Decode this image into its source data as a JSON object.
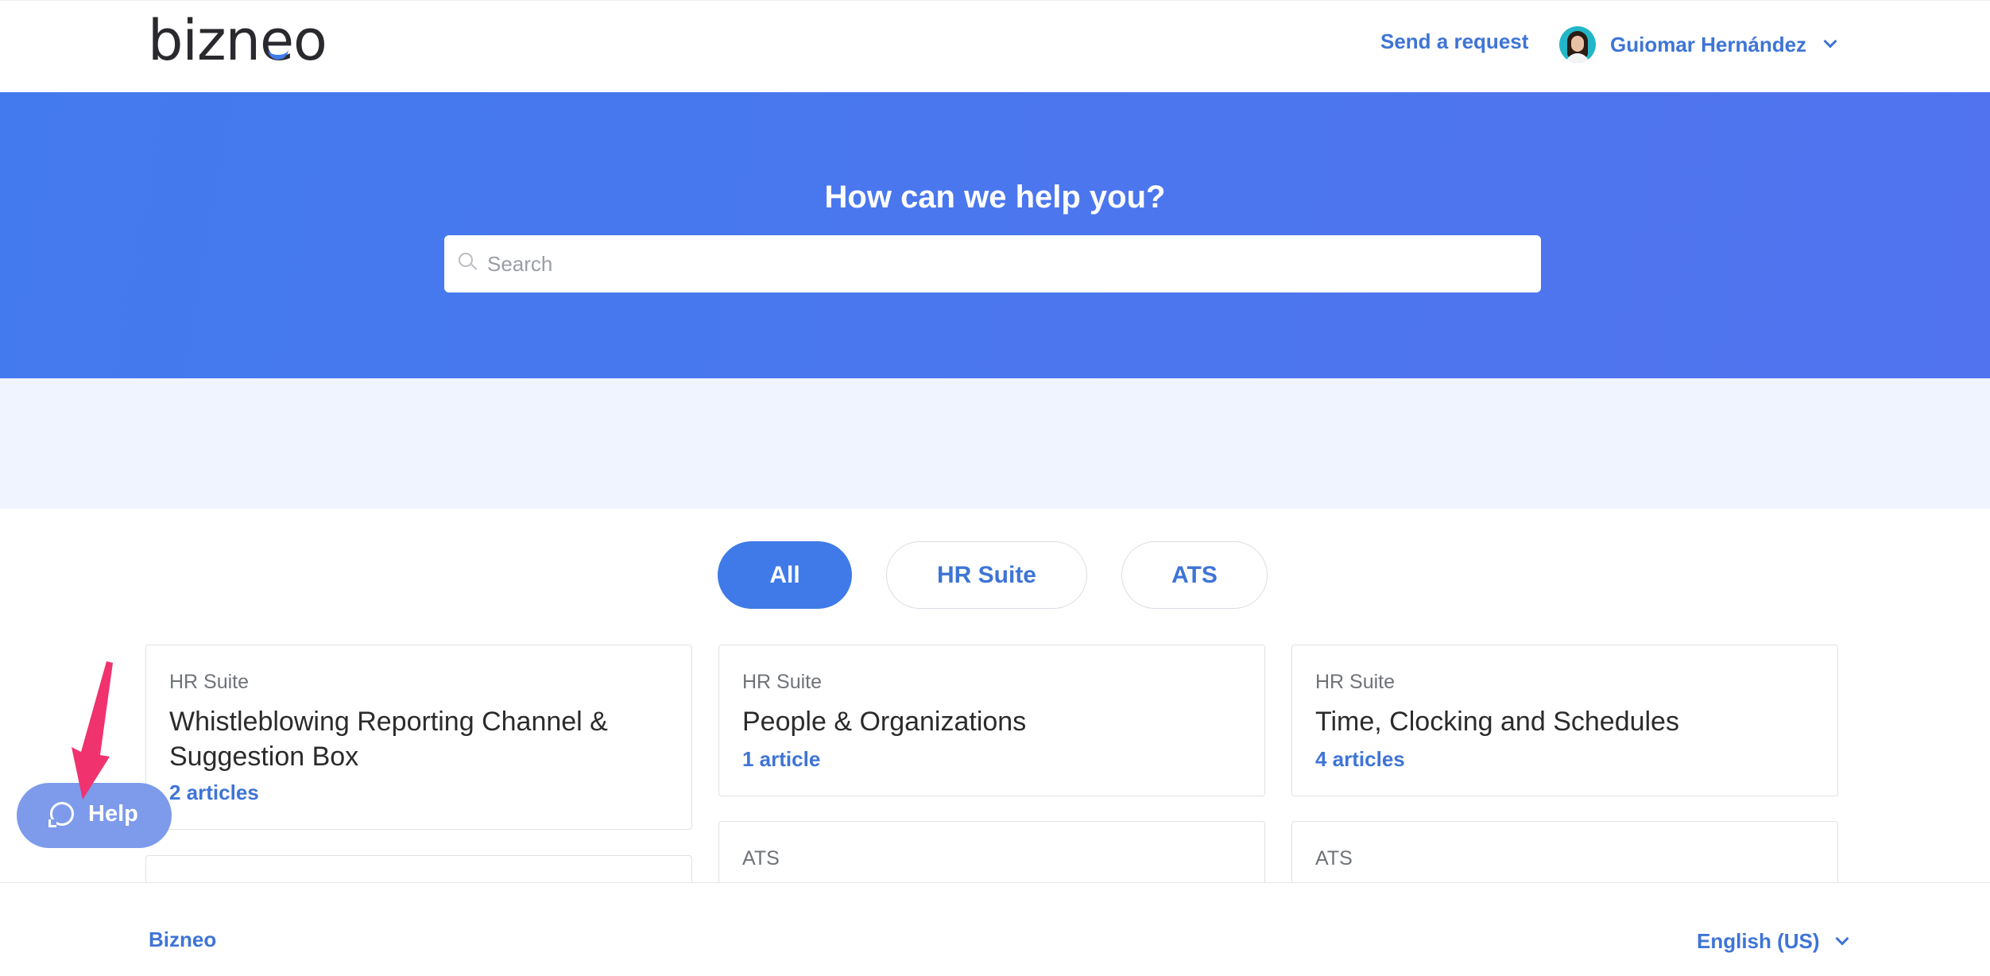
{
  "header": {
    "logo": "bizneo",
    "send_request": "Send a request",
    "user_name": "Guiomar Hernández"
  },
  "hero": {
    "title": "How can we help you?",
    "search_placeholder": "Search"
  },
  "filters": [
    {
      "label": "All",
      "active": true
    },
    {
      "label": "HR Suite",
      "active": false
    },
    {
      "label": "ATS",
      "active": false
    }
  ],
  "cards": [
    {
      "category": "HR Suite",
      "title_line1": "Whistleblowing Reporting Channel &",
      "title_line2": "Suggestion Box",
      "count": "2 articles"
    },
    {
      "category": "HR Suite",
      "title_line1": "People & Organizations",
      "count": "1 article"
    },
    {
      "category": "HR Suite",
      "title_line1": "Time, Clocking and Schedules",
      "count": "4 articles"
    },
    {
      "category": "ATS"
    },
    {
      "category": "ATS"
    }
  ],
  "footer": {
    "brand": "Bizneo",
    "language": "English (US)"
  },
  "help_widget": {
    "label": "Help"
  },
  "colors": {
    "accent": "#3f7ae8",
    "link": "#3e74d6",
    "hero_bg": "#4a77ee",
    "band_bg": "#eff4fe",
    "help_bg": "#7d9bea",
    "annotation_arrow": "#f0326e"
  }
}
